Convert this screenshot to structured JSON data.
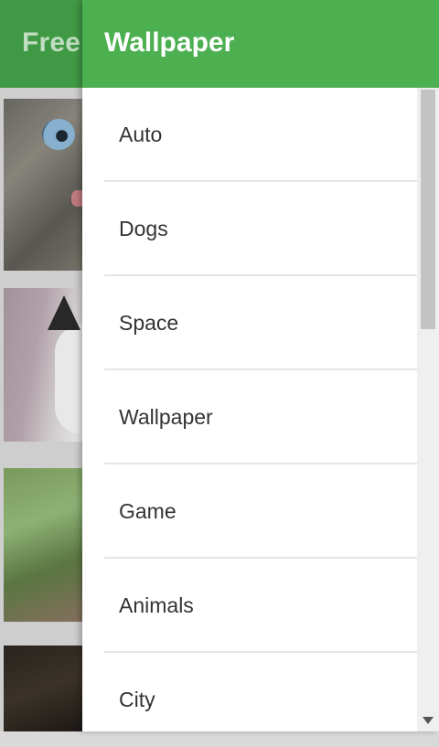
{
  "app": {
    "title": "Free"
  },
  "drawer": {
    "title": "Wallpaper",
    "items": [
      {
        "label": "Auto"
      },
      {
        "label": "Dogs"
      },
      {
        "label": "Space"
      },
      {
        "label": "Wallpaper"
      },
      {
        "label": "Game"
      },
      {
        "label": "Animals"
      },
      {
        "label": "City"
      }
    ]
  },
  "colors": {
    "header": "#4caf50",
    "app_bar": "#43a047"
  }
}
